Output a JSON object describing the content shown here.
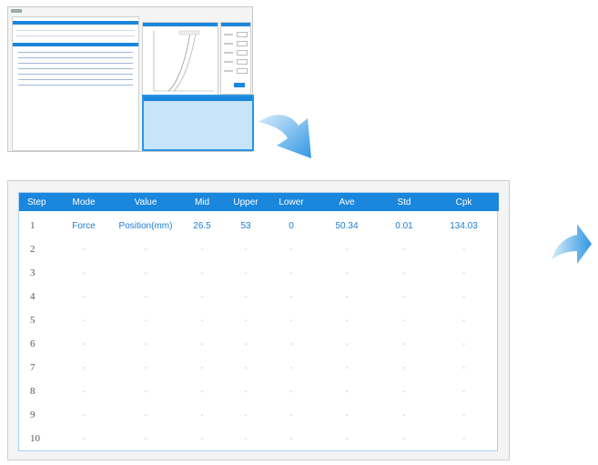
{
  "thumbnail": {
    "description_hidden": ""
  },
  "table": {
    "headers": {
      "step": "Step",
      "mode": "Mode",
      "value": "Value",
      "mid": "Mid",
      "upper": "Upper",
      "lower": "Lower",
      "ave": "Ave",
      "std": "Std",
      "cpk": "Cpk"
    },
    "rows": [
      {
        "step": "1",
        "mode": "Force",
        "value": "Position(mm)",
        "mid": "26.5",
        "upper": "53",
        "lower": "0",
        "ave": "50.34",
        "std": "0.01",
        "cpk": "134.03"
      },
      {
        "step": "2",
        "mode": "-",
        "value": "-",
        "mid": "-",
        "upper": "-",
        "lower": "-",
        "ave": "-",
        "std": "-",
        "cpk": "-"
      },
      {
        "step": "3",
        "mode": "-",
        "value": "-",
        "mid": "-",
        "upper": "-",
        "lower": "-",
        "ave": "-",
        "std": "-",
        "cpk": "-"
      },
      {
        "step": "4",
        "mode": "-",
        "value": "-",
        "mid": "-",
        "upper": "-",
        "lower": "-",
        "ave": "-",
        "std": "-",
        "cpk": "-"
      },
      {
        "step": "5",
        "mode": "-",
        "value": "-",
        "mid": "-",
        "upper": "-",
        "lower": "-",
        "ave": "-",
        "std": "-",
        "cpk": "-"
      },
      {
        "step": "6",
        "mode": "-",
        "value": "-",
        "mid": "-",
        "upper": "-",
        "lower": "-",
        "ave": "-",
        "std": "-",
        "cpk": "-"
      },
      {
        "step": "7",
        "mode": "-",
        "value": "-",
        "mid": "-",
        "upper": "-",
        "lower": "-",
        "ave": "-",
        "std": "-",
        "cpk": "-"
      },
      {
        "step": "8",
        "mode": "-",
        "value": "-",
        "mid": "-",
        "upper": "-",
        "lower": "-",
        "ave": "-",
        "std": "-",
        "cpk": "-"
      },
      {
        "step": "9",
        "mode": "-",
        "value": "-",
        "mid": "-",
        "upper": "-",
        "lower": "-",
        "ave": "-",
        "std": "-",
        "cpk": "-"
      },
      {
        "step": "10",
        "mode": "-",
        "value": "-",
        "mid": "-",
        "upper": "-",
        "lower": "-",
        "ave": "-",
        "std": "-",
        "cpk": "-"
      }
    ]
  },
  "colors": {
    "accent": "#1a86dc",
    "highlight": "#c7e4f8",
    "arrow": "#3aa0e6"
  },
  "icons": {
    "zoom_arrow": "curved-arrow-icon",
    "next_arrow": "curved-arrow-icon"
  }
}
